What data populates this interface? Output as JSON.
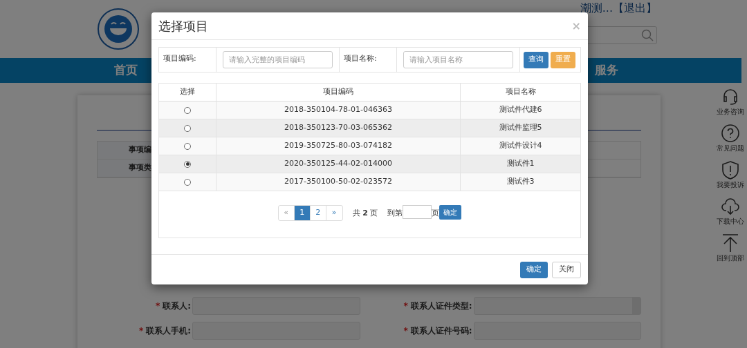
{
  "page": {
    "header": {
      "user": "潮测...",
      "logout": "【退出】"
    },
    "nav": [
      "首页",
      "服务"
    ],
    "info_labels": [
      "事项编",
      "事项类"
    ],
    "form": [
      {
        "marker": "*",
        "label": "联系人:",
        "kind": "input"
      },
      {
        "marker": "*",
        "label": "联系人证件类型:",
        "kind": "select"
      },
      {
        "marker": "*",
        "label": "联系人手机:",
        "kind": "input"
      },
      {
        "marker": "*",
        "label": "联系人证件号码:",
        "kind": "input"
      }
    ],
    "side_tools": [
      {
        "label": "业务咨询",
        "kind": "headset"
      },
      {
        "label": "常见问题",
        "kind": "question"
      },
      {
        "label": "我要投诉",
        "kind": "shield"
      },
      {
        "label": "下载中心",
        "kind": "download"
      },
      {
        "label": "回到顶部",
        "kind": "top"
      }
    ]
  },
  "modal": {
    "title": "选择项目",
    "close": "×",
    "search": [
      {
        "label": "项目编码:",
        "placeholder": "请输入完整的项目编码"
      },
      {
        "label": "项目名称:",
        "placeholder": "请输入项目名称"
      }
    ],
    "query_button": "查询",
    "reset_button": "重置",
    "columns": [
      "选择",
      "项目编码",
      "项目名称"
    ],
    "rows": [
      {
        "selected": false,
        "code": "2018-350104-78-01-046363",
        "name": "测试件代建6"
      },
      {
        "selected": false,
        "code": "2018-350123-70-03-065362",
        "name": "测试件监理5"
      },
      {
        "selected": false,
        "code": "2019-350725-80-03-074182",
        "name": "测试件设计4"
      },
      {
        "selected": true,
        "code": "2020-350125-44-02-014000",
        "name": "测试件1"
      },
      {
        "selected": false,
        "code": "2017-350100-50-02-023572",
        "name": "测试件3"
      }
    ],
    "pagination": {
      "prev": "«",
      "pages": [
        {
          "label": "1",
          "selected": true
        },
        {
          "label": "2",
          "selected": false
        }
      ],
      "next": "»",
      "total": "共 **2** 页",
      "goto": "到第",
      "page_unit": "页",
      "go_button": "确定"
    },
    "ok_button": "确定",
    "close_button": "关闭"
  }
}
